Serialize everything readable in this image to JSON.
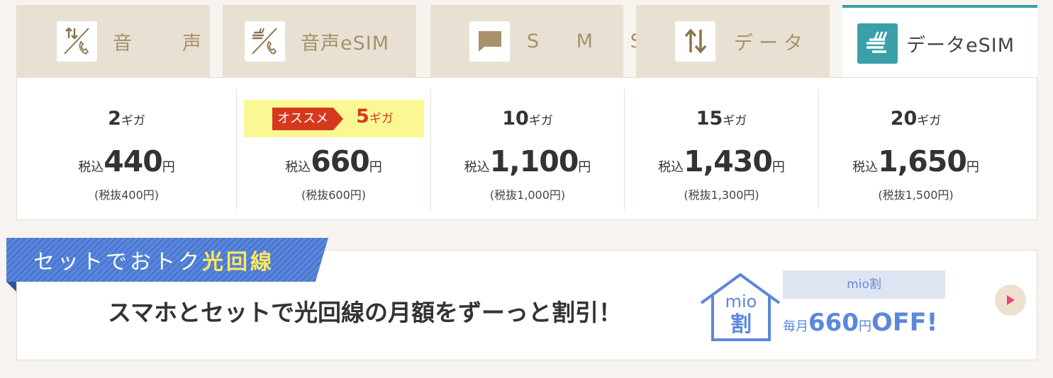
{
  "tabs": [
    {
      "label": "音　声",
      "icon": "voice-phone-icon"
    },
    {
      "label": "音声eSIM",
      "icon": "voice-esim-icon"
    },
    {
      "label": "S M S",
      "icon": "sms-chat-icon"
    },
    {
      "label": "データ",
      "icon": "data-arrows-icon"
    },
    {
      "label": "データeSIM",
      "icon": "data-esim-icon"
    }
  ],
  "active_tab": 4,
  "plans": [
    {
      "gb": "2",
      "gb_unit": "ギガ",
      "price_prefix": "税込",
      "price": "440",
      "price_suffix": "円",
      "tax_excluded": "(税抜400円)"
    },
    {
      "gb": "5",
      "gb_unit": "ギガ",
      "price_prefix": "税込",
      "price": "660",
      "price_suffix": "円",
      "tax_excluded": "(税抜600円)",
      "recommend": "オススメ"
    },
    {
      "gb": "10",
      "gb_unit": "ギガ",
      "price_prefix": "税込",
      "price": "1,100",
      "price_suffix": "円",
      "tax_excluded": "(税抜1,000円)"
    },
    {
      "gb": "15",
      "gb_unit": "ギガ",
      "price_prefix": "税込",
      "price": "1,430",
      "price_suffix": "円",
      "tax_excluded": "(税抜1,300円)"
    },
    {
      "gb": "20",
      "gb_unit": "ギガ",
      "price_prefix": "税込",
      "price": "1,650",
      "price_suffix": "円",
      "tax_excluded": "(税抜1,500円)"
    }
  ],
  "banner": {
    "ribbon_text": "セットでおトク",
    "ribbon_highlight": "光回線",
    "message": "スマホとセットで光回線の月額をずーっと割引！",
    "logo_line1": "mio",
    "logo_line2": "割",
    "mio_label": "mio割",
    "offer_prefix": "毎月",
    "offer_amount": "660",
    "offer_unit": "円",
    "offer_off": "OFF!"
  },
  "colors": {
    "accent_teal": "#3aa0a8",
    "tab_bg": "#e8e1d3",
    "tab_text": "#a8916b",
    "recommend_red": "#d6381e",
    "highlight_yellow": "#fbf894",
    "banner_blue": "#5b88dc",
    "play_pink": "#e8457a"
  }
}
